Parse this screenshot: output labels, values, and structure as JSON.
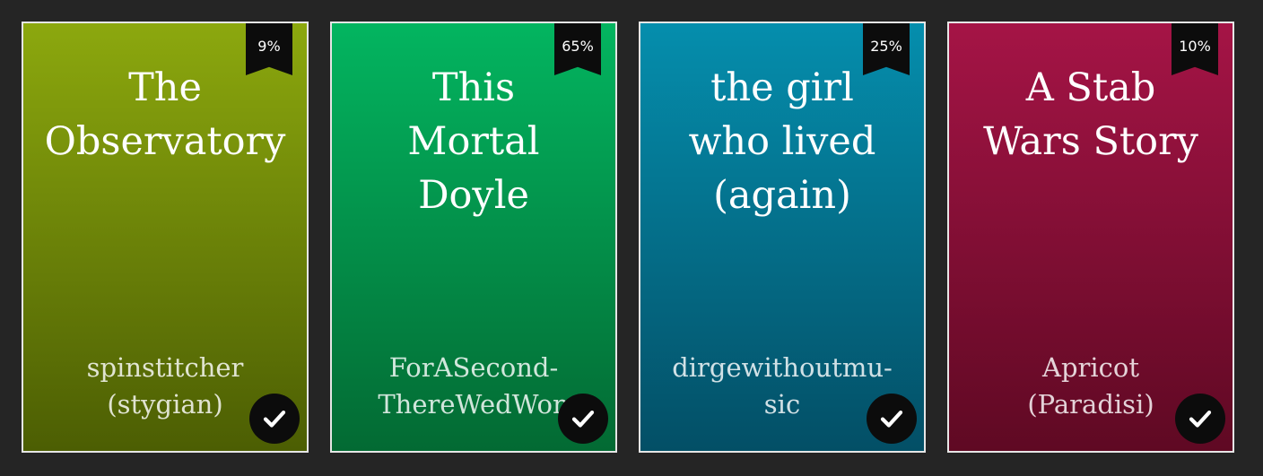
{
  "books": [
    {
      "title": "The\nObservatory",
      "author": "spinstitcher\n(stygian)",
      "progress": "9%",
      "colors": {
        "top": "#8ca80e",
        "bottom": "#4c5e03"
      },
      "check_icon": "checkmark-icon"
    },
    {
      "title": "This\nMortal\nDoyle",
      "author": "ForASecond-\nThereWedWon",
      "progress": "65%",
      "colors": {
        "top": "#03b560",
        "bottom": "#036a33"
      },
      "check_icon": "checkmark-icon"
    },
    {
      "title": "the girl\nwho lived\n(again)",
      "author": "dirgewithoutmu-\nsic",
      "progress": "25%",
      "colors": {
        "top": "#058ead",
        "bottom": "#034f66"
      },
      "check_icon": "checkmark-icon"
    },
    {
      "title": "A Stab\nWars Story",
      "author": "Apricot\n(Paradisi)",
      "progress": "10%",
      "colors": {
        "top": "#a51446",
        "bottom": "#5f0923"
      },
      "check_icon": "checkmark-icon"
    }
  ]
}
